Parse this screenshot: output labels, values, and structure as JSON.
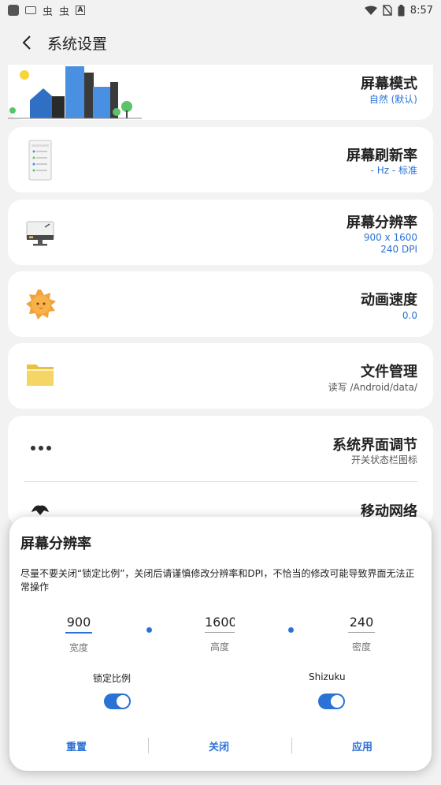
{
  "status_bar": {
    "time": "8:57",
    "ime_glyph_1": "虫",
    "ime_glyph_2": "虫",
    "a_box": "A"
  },
  "app_bar": {
    "title": "系统设置"
  },
  "items": [
    {
      "title": "屏幕模式",
      "sub": "自然 (默认)",
      "icon": "city-illustration-icon"
    },
    {
      "title": "屏幕刷新率",
      "sub": "- Hz - 标准",
      "icon": "phone-screen-icon"
    },
    {
      "title": "屏幕分辨率",
      "sub": "900 x 1600",
      "sub2": "240 DPI",
      "icon": "monitor-icon"
    },
    {
      "title": "动画速度",
      "sub": "0.0",
      "icon": "sun-icon"
    },
    {
      "title": "文件管理",
      "sub": "读写 /Android/data/",
      "icon": "folder-icon"
    },
    {
      "title": "系统界面调节",
      "sub": "开关状态栏图标",
      "icon": "more-dots-icon"
    },
    {
      "title": "移动网络",
      "icon": "network-icon"
    }
  ],
  "dialog": {
    "title": "屏幕分辨率",
    "message": "尽量不要关闭“锁定比例”，关闭后请谨慎修改分辨率和DPI，不恰当的修改可能导致界面无法正常操作",
    "width_value": "900",
    "width_label": "宽度",
    "height_value": "1600",
    "height_label": "高度",
    "density_value": "240",
    "density_label": "密度",
    "lock_ratio_label": "锁定比例",
    "lock_ratio_on": true,
    "shizuku_label": "Shizuku",
    "shizuku_on": true,
    "reset_label": "重置",
    "close_label": "关闭",
    "apply_label": "应用"
  },
  "colors": {
    "accent": "#2a72d6",
    "background": "#f2f2f2",
    "card": "#ffffff"
  }
}
